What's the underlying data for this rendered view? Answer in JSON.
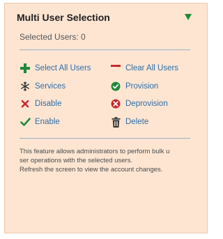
{
  "panel": {
    "title": "Multi User Selection",
    "selected_users": "Selected Users: 0"
  },
  "actions": {
    "select_all": {
      "label": "Select All Users",
      "icon": "plus-icon"
    },
    "clear_all": {
      "label": "Clear All Users",
      "icon": "minus-icon"
    },
    "services": {
      "label": "Services",
      "icon": "snowflake-icon"
    },
    "provision": {
      "label": "Provision",
      "icon": "check-circle-icon"
    },
    "disable": {
      "label": "Disable",
      "icon": "x-icon"
    },
    "deprovision": {
      "label": "Deprovision",
      "icon": "x-circle-icon"
    },
    "enable": {
      "label": "Enable",
      "icon": "checkmark-icon"
    },
    "delete": {
      "label": "Delete",
      "icon": "trash-icon"
    }
  },
  "description": {
    "line1": "This feature allows administrators to perform bulk u",
    "line2": "ser operations with the selected users.",
    "line3": "Refresh the screen to view the account changes."
  },
  "colors": {
    "panel_bg": "#fde5d2",
    "link": "#2d6ea8",
    "green": "#1f8a3a",
    "red": "#c8282f"
  }
}
